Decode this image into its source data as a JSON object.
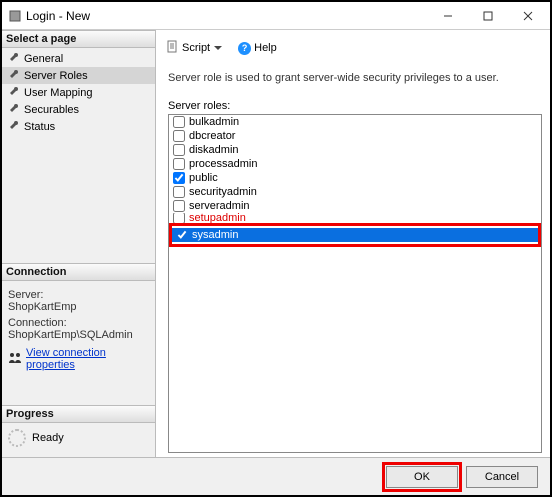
{
  "window": {
    "title": "Login - New"
  },
  "sidebar": {
    "pages_header": "Select a page",
    "pages": [
      {
        "label": "General",
        "selected": false
      },
      {
        "label": "Server Roles",
        "selected": true
      },
      {
        "label": "User Mapping",
        "selected": false
      },
      {
        "label": "Securables",
        "selected": false
      },
      {
        "label": "Status",
        "selected": false
      }
    ],
    "connection_header": "Connection",
    "server_label": "Server:",
    "server_value": "ShopKartEmp",
    "connection_label": "Connection:",
    "connection_value": "ShopKartEmp\\SQLAdmin",
    "view_props": "View connection properties",
    "progress_header": "Progress",
    "progress_status": "Ready"
  },
  "main": {
    "script_label": "Script",
    "help_label": "Help",
    "description": "Server role is used to grant server-wide security privileges to a user.",
    "roles_label": "Server roles:",
    "roles": [
      {
        "name": "bulkadmin",
        "checked": false
      },
      {
        "name": "dbcreator",
        "checked": false
      },
      {
        "name": "diskadmin",
        "checked": false
      },
      {
        "name": "processadmin",
        "checked": false
      },
      {
        "name": "public",
        "checked": true
      },
      {
        "name": "securityadmin",
        "checked": false
      },
      {
        "name": "serveradmin",
        "checked": false
      },
      {
        "name": "setupadmin",
        "checked": false
      },
      {
        "name": "sysadmin",
        "checked": true,
        "selected": true
      }
    ]
  },
  "footer": {
    "ok": "OK",
    "cancel": "Cancel"
  }
}
